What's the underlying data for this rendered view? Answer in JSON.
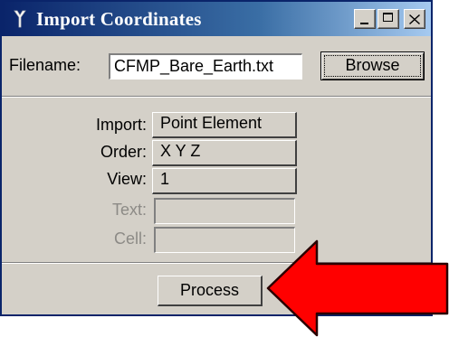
{
  "window": {
    "title": "Import Coordinates"
  },
  "filename": {
    "label": "Filename:",
    "value": "CFMP_Bare_Earth.txt",
    "browse_label": "Browse"
  },
  "fields": {
    "import": {
      "label": "Import:",
      "value": "Point Element"
    },
    "order": {
      "label": "Order:",
      "value": "X Y Z"
    },
    "view": {
      "label": "View:",
      "value": "1"
    },
    "text": {
      "label": "Text:",
      "value": ""
    },
    "cell": {
      "label": "Cell:",
      "value": ""
    }
  },
  "process": {
    "label": "Process"
  },
  "colors": {
    "arrow": "#ff0000",
    "titlebar": "#0a246a",
    "face": "#d4d0c8"
  }
}
